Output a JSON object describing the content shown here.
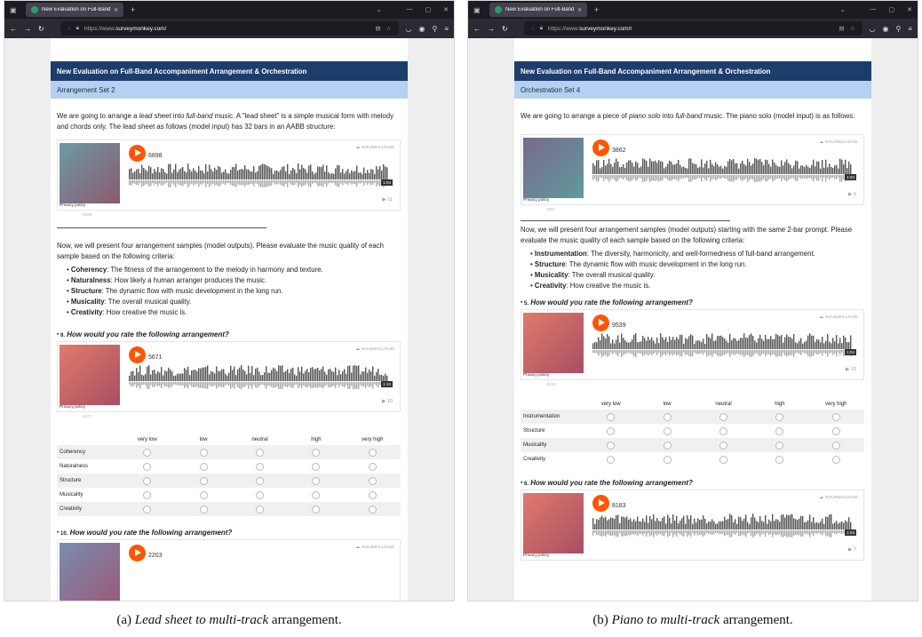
{
  "browser": {
    "tab_title": "New Evaluation on Full-Band A",
    "url_prefix": "https://www.",
    "url_domain_a": "surveymonkey.com/",
    "url_domain_b": "surveymonkey.com/r"
  },
  "panel_a": {
    "survey_title": "New Evaluation on Full-Band Accompaniment Arrangement & Orchestration",
    "section": "Arrangement Set 2",
    "intro_1": "We are going to arrange a ",
    "intro_em1": "lead sheet",
    "intro_2": " into ",
    "intro_em2": "full-band",
    "intro_3": " music. A \"lead sheet\" is a simple musical form with melody and chords only. The lead sheet as follows (model input) has 32 bars in an AABB structure:",
    "player_1": {
      "count": "6898",
      "time": "1:04",
      "plays": "▶ 11",
      "under": "6898"
    },
    "criteria_intro": "Now, we will present four arrangement samples (model outputs). Please evaluate the music quality of each sample based on the following criteria:",
    "criteria": [
      {
        "name": "Coherency",
        "desc": ": The fitness of the arrangement to the melody in harmony and texture."
      },
      {
        "name": "Naturalness",
        "desc": ": How likely a human arranger produces the music."
      },
      {
        "name": "Structure",
        "desc": ": The dynamic flow with music development in the long run."
      },
      {
        "name": "Musicality",
        "desc": ": The overall musical quality."
      },
      {
        "name": "Creativity",
        "desc": ": How creative the music is."
      }
    ],
    "q1": {
      "num": "* 9.",
      "text": " How would you rate the following arrangement?"
    },
    "player_2": {
      "count": "5671",
      "time": "1:10",
      "plays": "▶ 10",
      "under": "5671"
    },
    "scale": [
      "very low",
      "low",
      "neutral",
      "high",
      "very high"
    ],
    "rows": [
      "Coherency",
      "Naturalness",
      "Structure",
      "Musicality",
      "Creativity"
    ],
    "q2": {
      "num": "* 10.",
      "text": " How would you rate the following arrangement?"
    },
    "player_3": {
      "count": "2203"
    }
  },
  "panel_b": {
    "survey_title": "New Evaluation on Full-Band Accompaniment Arrangement & Orchestration",
    "section": "Orchestration Set 4",
    "intro_1": "We are going to arrange a piece of ",
    "intro_em1": "piano solo",
    "intro_2": " into ",
    "intro_em2": "full-band",
    "intro_3": " music. The piano solo (model input) is as follows:",
    "player_1": {
      "count": "3862",
      "time": "1:04",
      "plays": "▶ 9",
      "under": "3862"
    },
    "criteria_intro": "Now, we will present four arrangement samples (model outputs) starting with the same 2-bar prompt. Please evaluate the music quality of each sample based on the following criteria:",
    "criteria": [
      {
        "name": "Instrumentation",
        "desc": ": The diversity, harmonicity, and well-formedness of full-band arrangement."
      },
      {
        "name": "Structure",
        "desc": ": The dynamic flow with music development in the long run."
      },
      {
        "name": "Musicality",
        "desc": ": The overall musical quality."
      },
      {
        "name": "Creativity",
        "desc": ": How creative the music is."
      }
    ],
    "q1": {
      "num": "* 5.",
      "text": " How would you rate the following arrangement?"
    },
    "player_2": {
      "count": "9539",
      "time": "1:04",
      "plays": "▶ 10",
      "under": "9539"
    },
    "scale": [
      "very low",
      "low",
      "neutral",
      "high",
      "very high"
    ],
    "rows": [
      "Instrumentation",
      "Structure",
      "Musicality",
      "Creativity"
    ],
    "q2": {
      "num": "* 6.",
      "text": " How would you rate the following arrangement?"
    },
    "player_3": {
      "count": "8183",
      "time": "1:04",
      "plays": "▶ 7",
      "under": "8183"
    }
  },
  "soundcloud_brand": "SOUNDCLOUD",
  "privacy": "Privacy policy",
  "colors": {
    "header": "#1d3d6b",
    "section": "#b6d0f2",
    "play": "#ff5500"
  },
  "captions": {
    "a_pre": "(a) ",
    "a_em": "Lead sheet to multi-track",
    "a_post": " arrangement.",
    "b_pre": "(b) ",
    "b_em": "Piano to multi-track",
    "b_post": " arrangement."
  }
}
